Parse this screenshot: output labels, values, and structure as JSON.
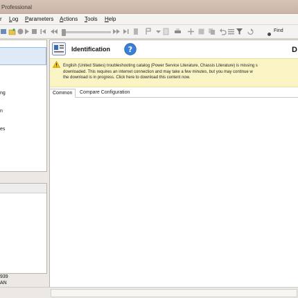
{
  "window": {
    "title": "Professional"
  },
  "menu": {
    "items": [
      {
        "label": "Log",
        "key": "L",
        "rest": "og"
      },
      {
        "label": "Parameters",
        "key": "P",
        "rest": "arameters"
      },
      {
        "label": "Actions",
        "key": "A",
        "rest": "ctions"
      },
      {
        "label": "Tools",
        "key": "T",
        "rest": "ools"
      },
      {
        "label": "Help",
        "key": "H",
        "rest": "elp"
      }
    ]
  },
  "toolbar": {
    "find_label": "Find"
  },
  "left_tree": {
    "items": [
      {
        "label": "ng"
      },
      {
        "label": "n"
      },
      {
        "label": "es"
      }
    ]
  },
  "left_info": {
    "line1": "939",
    "line2": "AN"
  },
  "main": {
    "header_title": "Identification",
    "header_suffix": "D",
    "warning": {
      "line1": "English (United States) troubleshooting catalog (Power Service Literature, Chassis Literature) is missing s",
      "line2": "downloaded. This requires an internet connection and may take a few minutes, but you may continue w",
      "line3": "the download is in progress. Click here to download this content now."
    },
    "tabs": [
      {
        "label": "Common"
      },
      {
        "label": "Compare Configuration"
      }
    ]
  },
  "colors": {
    "title_bar": "#d7c3b8",
    "selection": "#dfeaf7",
    "warning_bg": "#fbf5c6",
    "help_blue": "#3b7fd6",
    "warning_yellow": "#f2c200"
  }
}
